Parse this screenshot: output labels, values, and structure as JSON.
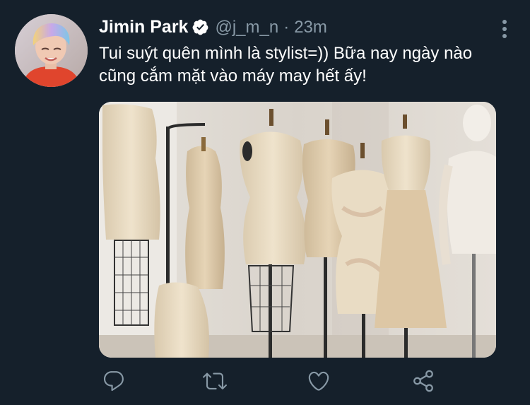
{
  "tweet": {
    "display_name": "Jimin Park",
    "handle": "@j_m_n",
    "separator": "·",
    "time": "23m",
    "text": "Tui suýt quên mình là stylist=)) Bữa nay ngày nào cũng cắm mặt vào máy may hết ấy!",
    "verified": true
  },
  "icons": {
    "verified": "verified-badge-icon",
    "more": "more-vertical-icon",
    "reply": "reply-icon",
    "retweet": "retweet-icon",
    "like": "heart-icon",
    "share": "share-icon"
  },
  "colors": {
    "background": "#15202b",
    "text_primary": "#ffffff",
    "text_secondary": "#8899a6"
  }
}
